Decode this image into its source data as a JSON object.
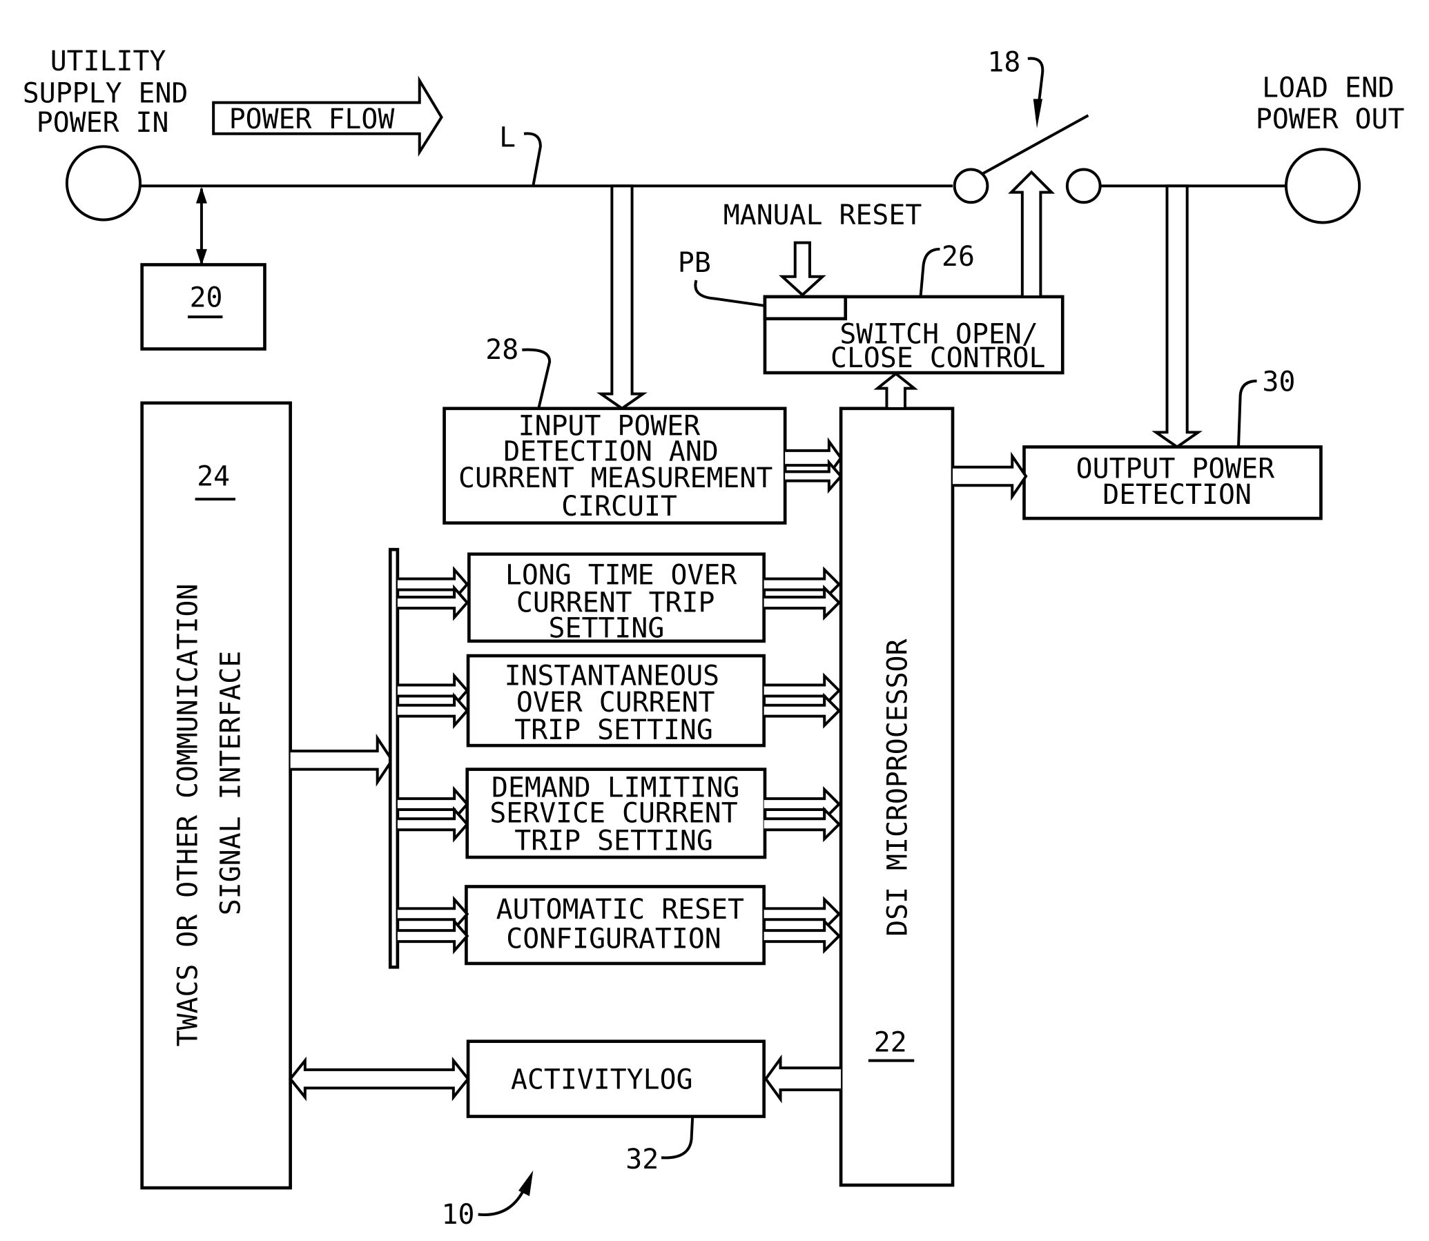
{
  "diagram": {
    "figure_ref": "10",
    "supply": {
      "lines": [
        "UTILITY",
        "SUPPLY END",
        "POWER IN"
      ]
    },
    "power_flow": "POWER FLOW",
    "line_label": "L",
    "switch_ref": "18",
    "load": {
      "lines": [
        "LOAD END",
        "POWER OUT"
      ]
    },
    "manual_reset": "MANUAL RESET",
    "pb_label": "PB",
    "box20": "20",
    "box24": {
      "ref": "24",
      "lines": [
        "TWACS OR OTHER COMMUNICATION",
        "SIGNAL INTERFACE"
      ]
    },
    "box26": {
      "ref": "26",
      "lines": [
        "SWITCH OPEN/",
        "CLOSE CONTROL"
      ]
    },
    "box28": {
      "ref": "28",
      "lines": [
        "INPUT POWER",
        "DETECTION AND",
        "CURRENT MEASUREMENT",
        "CIRCUIT"
      ]
    },
    "box30": {
      "ref": "30",
      "lines": [
        "OUTPUT POWER",
        "DETECTION"
      ]
    },
    "box22": {
      "ref": "22",
      "label": "DSI MICROPROCESSOR"
    },
    "settings": [
      {
        "lines": [
          "LONG TIME OVER",
          "CURRENT TRIP",
          "SETTING"
        ]
      },
      {
        "lines": [
          "INSTANTANEOUS",
          "OVER CURRENT",
          "TRIP SETTING"
        ]
      },
      {
        "lines": [
          "DEMAND LIMITING",
          "SERVICE CURRENT",
          "TRIP SETTING"
        ]
      },
      {
        "lines": [
          "AUTOMATIC RESET",
          "CONFIGURATION"
        ]
      }
    ],
    "box32": {
      "ref": "32",
      "label": "ACTIVITYLOG"
    }
  }
}
